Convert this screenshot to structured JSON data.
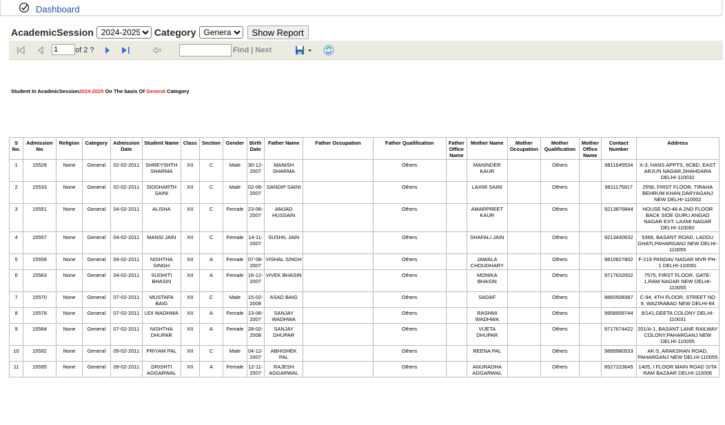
{
  "nav": {
    "dashboard_label": "Dashboard"
  },
  "filters": {
    "session_label": "AcademicSession",
    "session_value": "2024-2025",
    "category_label": "Category",
    "category_value": "General",
    "show_button": "Show Report"
  },
  "toolbar": {
    "page_value": "1",
    "of_text": "of 2 ?",
    "find_label": "Find",
    "separator": "|",
    "next_label": "Next"
  },
  "caption": {
    "prefix": "Student In AcadmicSession",
    "session": "2024-2025",
    "middle": " On The basis Of  ",
    "category": "General",
    "suffix": " Category"
  },
  "colors": {
    "accent_red": "#e21c1c",
    "toolbar_bg": "#ecebe2",
    "link_blue": "#1a4f9c"
  },
  "table": {
    "headers": [
      "S No.",
      "Admission No",
      "Religion",
      "Category",
      "Admission Date",
      "Student Name",
      "Class",
      "Section",
      "Gender",
      "Birth Date",
      "Father Name",
      "Father Occupation",
      "Father Qualification",
      "Father Office Name",
      "Mother Name",
      "Mother Occupation",
      "Mother Qualification",
      "Mother Office Name",
      "Contact Number",
      "Address"
    ],
    "rows": [
      [
        "1",
        "15528",
        "None",
        "General",
        "02-02-2011",
        "SHREYSHTH SHARMA",
        "XII",
        "C",
        "Male",
        "30-12-2007",
        "MANISH SHARMA",
        "",
        "Others",
        "",
        "MANINDER KAUR",
        "",
        "Others",
        "",
        "9811645534",
        "X-3, HANS APPTS, 6CBD, EAST ARJUN NAGAR,SHAHDARA DELHI-110032"
      ],
      [
        "2",
        "15533",
        "None",
        "General",
        "02-02-2011",
        "SIDDHARTH SAINI",
        "XII",
        "C",
        "Male",
        "02-06-2007",
        "SANDIP SAINI",
        "",
        "Others",
        "",
        "LAXMI SAINI",
        "",
        "Others",
        "",
        "9811175817",
        "2556, FIRST FLOOR, TIRAHA BEHRUM KHAN,DARYAGANJ NEW DELHI-110002"
      ],
      [
        "3",
        "15551",
        "None",
        "General",
        "04-02-2011",
        "ALISHA",
        "XII",
        "C",
        "Female",
        "23-06-2007",
        "AMJAD HUSSAIN",
        "",
        "Others",
        "",
        "AMARPREET KAUR",
        "",
        "Others",
        "",
        "9213876844",
        "HOUSE NO-48 A 2ND FLOOR BACK SIDE GURU ANGAD NAGAR EXT. LAXMI NAGAR DELHI-110092"
      ],
      [
        "4",
        "15557",
        "None",
        "General",
        "04-02-2011",
        "MANSI  JAIN",
        "XII",
        "C",
        "Female",
        "14-11-2007",
        "SUSHIL JAIN",
        "",
        "Others",
        "",
        "SHAFALI JAIN",
        "",
        "Others",
        "",
        "9213430632",
        "5368, BASANT ROAD, LADDU GHATI,PAHARGANJ NEW DELHI-110055"
      ],
      [
        "5",
        "15558",
        "None",
        "General",
        "04-02-2011",
        "NISHTHA SINGH",
        "XII",
        "A",
        "Female",
        "07-08-2007",
        "VISHAL SINGH",
        "",
        "Others",
        "",
        "JAWALA CHOUDHARY",
        "",
        "Others",
        "",
        "9810827802",
        "F-219 PANDAV NAGAR MVR PH-1 DELHI-110091"
      ],
      [
        "6",
        "15563",
        "None",
        "General",
        "04-02-2011",
        "SUDHITI BHASIN",
        "XII",
        "A",
        "Female",
        "16-12-2007",
        "VIVEK BHASIN",
        "",
        "Others",
        "",
        "MONIKA BHASIN",
        "",
        "Others",
        "",
        "9717632002",
        "7575, FIRST FLOOR, GATE-1,RAM NAGAR NEW DELHI-110055"
      ],
      [
        "7",
        "15570",
        "None",
        "General",
        "07-02-2011",
        "MUSTAFA BAIG",
        "XII",
        "C",
        "Male",
        "15-02-2008",
        "ASAD BAIG",
        "",
        "Others",
        "",
        "SADAF",
        "",
        "Others",
        "",
        "8860508387",
        "C-94, 4TH FLOOR, STREET NO 9, WAZIRABAD NEW DELHI-84"
      ],
      [
        "8",
        "15578",
        "None",
        "General",
        "07-02-2011",
        "UDI WADHWA",
        "XII",
        "A",
        "Female",
        "13-06-2007",
        "SANJAY WADHWA",
        "",
        "Others",
        "",
        "RASHMI WADHWA",
        "",
        "Others",
        "",
        "9958958744",
        "9/141,GEETA COLONY DELHI-110031"
      ],
      [
        "9",
        "15584",
        "None",
        "General",
        "07-02-2011",
        "NISHTHA DHUPAR",
        "XII",
        "A",
        "Female",
        "28-02-2008",
        "SANJAY DHUPAR",
        "",
        "Others",
        "",
        "VIJETA DHUPAR",
        "",
        "Others",
        "",
        "9717674422",
        "201/A-1, BASANT LANE RAILWAY COLONY,PAHARGANJ NEW DELHI-110055"
      ],
      [
        "10",
        "15592",
        "None",
        "General",
        "09-02-2011",
        "PRIYAM  PAL",
        "XII",
        "C",
        "Male",
        "04-12-2007",
        "ABHISHEK PAL",
        "",
        "Others",
        "",
        "REENA PAL",
        "",
        "Others",
        "",
        "9899980533",
        "AK-5, ARAKSHAN ROAD, PAHARGANJ NEW DELHI-110055"
      ],
      [
        "11",
        "15595",
        "None",
        "General",
        "09-02-2011",
        "DRISHTI AGGARWAL",
        "XII",
        "A",
        "Female",
        "12-11-2007",
        "RAJESH AGGARWAL",
        "",
        "Others",
        "",
        "ANURADHA AGGARWAL",
        "",
        "Others",
        "",
        "8527223645",
        "1405, I FLOOR MAIN ROAD SITA RAM BAZAAR DELHI-110006"
      ]
    ]
  }
}
